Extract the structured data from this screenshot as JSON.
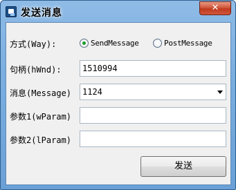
{
  "window": {
    "title": "发送消息",
    "close_glyph": "✕"
  },
  "form": {
    "way_label": "方式(Way):",
    "way_options": [
      {
        "label": "SendMessage",
        "selected": true
      },
      {
        "label": "PostMessage",
        "selected": false
      }
    ],
    "hwnd_label": "句柄(hWnd):",
    "hwnd_value": "1510994",
    "message_label": "消息(Message)",
    "message_value": "1124",
    "wparam_label": "参数1(wParam)",
    "wparam_value": "",
    "lparam_label": "参数2(lParam)",
    "lparam_value": "",
    "send_label": "发送"
  },
  "colors": {
    "radio_selected": "#1a9c2c",
    "titlebar": "#7aaedf",
    "close_button": "#c0391d"
  },
  "icons": {
    "app": "app-window-icon",
    "close": "close-icon",
    "dropdown": "chevron-down-icon"
  }
}
